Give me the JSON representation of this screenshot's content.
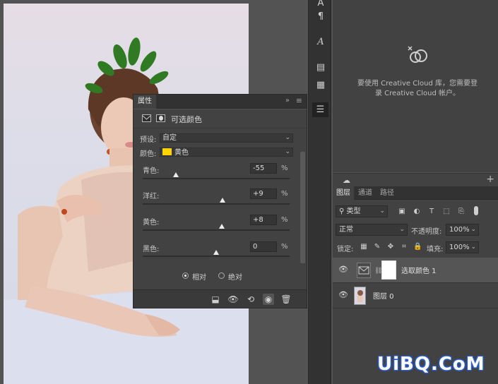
{
  "properties_panel": {
    "tab_label": "属性",
    "collapse_glyph": "»",
    "menu_glyph": "≡",
    "adjustment_title": "可选颜色",
    "preset_label": "预设:",
    "preset_value": "自定",
    "colors_label": "颜色:",
    "colors_value": "黄色",
    "colors_swatch": "#ffd400",
    "sliders": [
      {
        "label": "青色:",
        "value": "-55",
        "unit": "%",
        "level": -55
      },
      {
        "label": "洋红:",
        "value": "+9",
        "unit": "%",
        "level": 9
      },
      {
        "label": "黄色:",
        "value": "+8",
        "unit": "%",
        "level": 8
      },
      {
        "label": "黑色:",
        "value": "0",
        "unit": "%",
        "level": 0
      }
    ],
    "method_options": [
      {
        "label": "相对",
        "selected": true
      },
      {
        "label": "绝对",
        "selected": false
      }
    ],
    "footer_icons": [
      "clip-to-layer-icon",
      "view-previous-icon",
      "reset-icon",
      "visibility-icon",
      "delete-icon"
    ]
  },
  "tool_strip": {
    "icons": [
      "character-icon",
      "paragraph-icon",
      "glyphs-icon",
      "libraries-icon",
      "notes-icon",
      "properties-icon"
    ]
  },
  "libraries": {
    "message": "要使用 Creative Cloud 库，您需要登录 Creative Cloud 帐户。"
  },
  "layers_panel": {
    "tabs": [
      {
        "label": "图层",
        "active": true
      },
      {
        "label": "通道",
        "active": false
      },
      {
        "label": "路径",
        "active": false
      }
    ],
    "filter_kind": "类型",
    "blend_mode": "正常",
    "opacity_label": "不透明度:",
    "opacity_value": "100%",
    "lock_label": "锁定:",
    "fill_label": "填充:",
    "fill_value": "100%",
    "layers": [
      {
        "name": "选取颜色 1",
        "selected": true
      },
      {
        "name": "图层 0",
        "selected": false
      }
    ]
  },
  "watermark": "UiBQ.CoM"
}
